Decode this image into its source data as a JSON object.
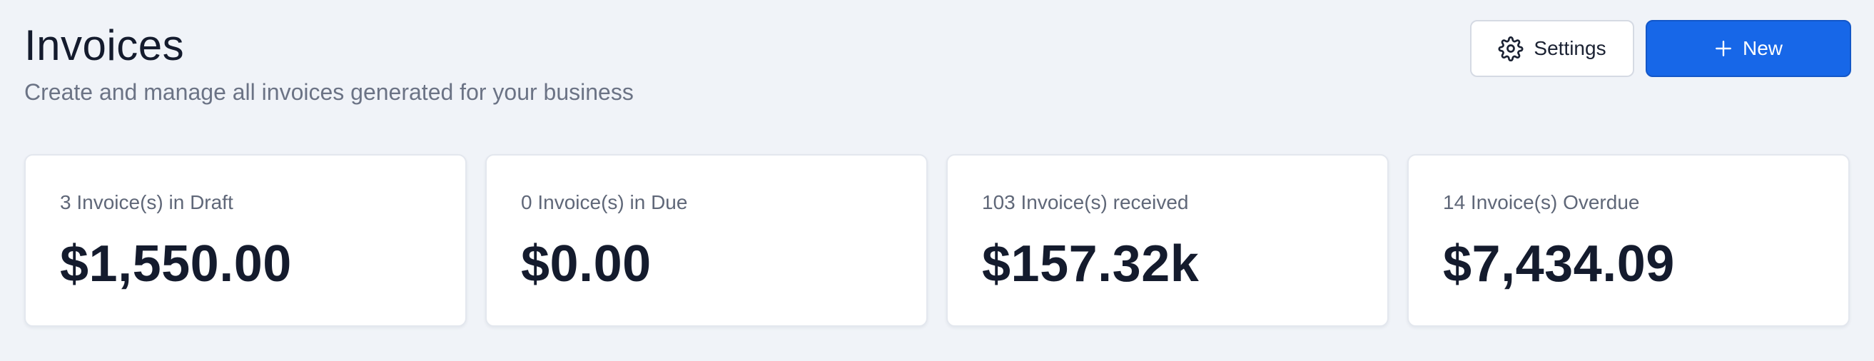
{
  "header": {
    "title": "Invoices",
    "subtitle": "Create and manage all invoices generated for your business"
  },
  "actions": {
    "settings_label": "Settings",
    "settings_icon": "gear-icon",
    "new_label": "New",
    "new_icon": "plus-icon"
  },
  "colors": {
    "background": "#f0f3f8",
    "primary": "#1767e8",
    "text": "#141b2d",
    "muted": "#6b7385"
  },
  "stats": [
    {
      "label": "3 Invoice(s) in Draft",
      "value": "$1,550.00"
    },
    {
      "label": "0 Invoice(s) in Due",
      "value": "$0.00"
    },
    {
      "label": "103 Invoice(s) received",
      "value": "$157.32k"
    },
    {
      "label": "14 Invoice(s) Overdue",
      "value": "$7,434.09"
    }
  ]
}
